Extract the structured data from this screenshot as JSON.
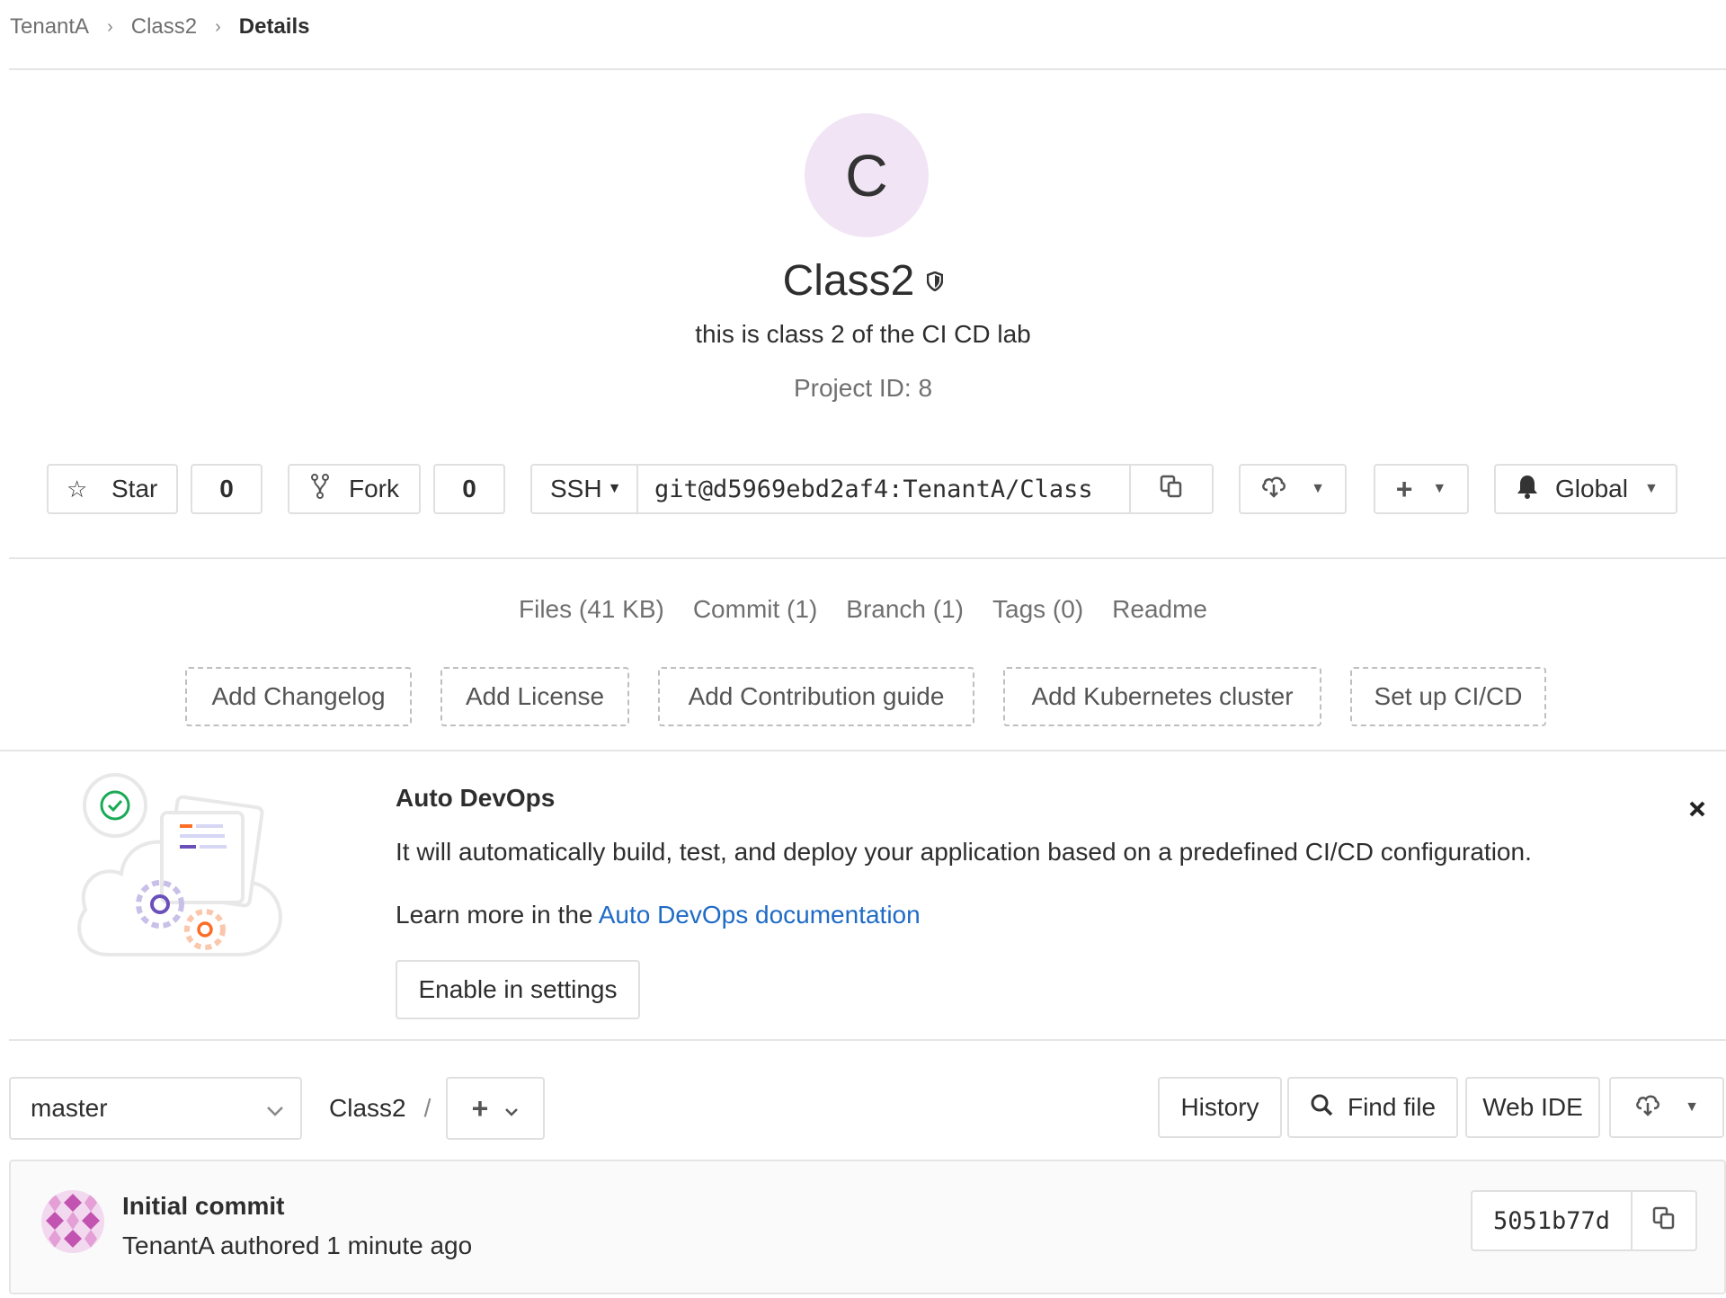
{
  "breadcrumb": {
    "items": [
      "TenantA",
      "Class2",
      "Details"
    ]
  },
  "project": {
    "avatar_letter": "C",
    "name": "Class2",
    "description": "this is class 2 of the CI CD lab",
    "project_id": "Project ID: 8"
  },
  "actions": {
    "star_label": "Star",
    "star_count": "0",
    "fork_label": "Fork",
    "fork_count": "0",
    "clone_protocol": "SSH",
    "clone_url": "git@d5969ebd2af4:TenantA/Class",
    "notification_label": "Global"
  },
  "stats": [
    "Files (41 KB)",
    "Commit (1)",
    "Branch (1)",
    "Tags (0)",
    "Readme"
  ],
  "quick_actions": [
    "Add Changelog",
    "Add License",
    "Add Contribution guide",
    "Add Kubernetes cluster",
    "Set up CI/CD"
  ],
  "auto_devops": {
    "title": "Auto DevOps",
    "description": "It will automatically build, test, and deploy your application based on a predefined CI/CD configuration.",
    "learn_prefix": "Learn more in the ",
    "learn_link": "Auto DevOps documentation",
    "enable_label": "Enable in settings"
  },
  "tree": {
    "branch": "master",
    "path_root": "Class2",
    "path_sep": "/",
    "history_label": "History",
    "find_file_label": "Find file",
    "web_ide_label": "Web IDE"
  },
  "last_commit": {
    "title": "Initial commit",
    "author_line": "TenantA authored 1 minute ago",
    "sha": "5051b77d"
  },
  "colors": {
    "link": "#1f6bc5",
    "avatar_bg": "#f1e4f5",
    "border": "#e0e0e0",
    "success": "#1aaa55",
    "gear_purple": "#6b4fbb",
    "gear_orange": "#fc6d26"
  }
}
